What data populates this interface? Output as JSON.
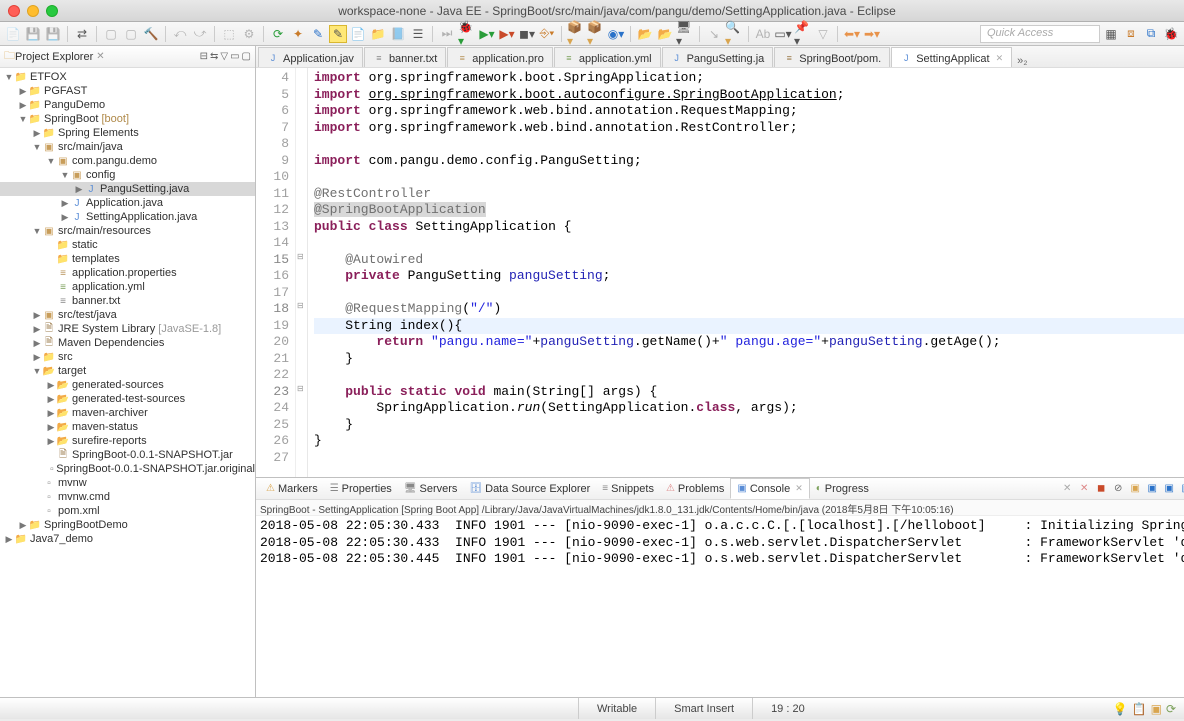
{
  "title": "workspace-none - Java EE - SpringBoot/src/main/java/com/pangu/demo/SettingApplication.java - Eclipse",
  "quick_access": "Quick Access",
  "project_explorer": {
    "title": "Project Explorer",
    "items": [
      {
        "depth": 0,
        "tw": "▼",
        "icon": "proj",
        "label": "ETFOX"
      },
      {
        "depth": 1,
        "tw": "▶",
        "icon": "proj",
        "label": "PGFAST"
      },
      {
        "depth": 1,
        "tw": "▶",
        "icon": "proj",
        "label": "PanguDemo"
      },
      {
        "depth": 1,
        "tw": "▼",
        "icon": "proj",
        "label": "SpringBoot",
        "deco": " [boot]"
      },
      {
        "depth": 2,
        "tw": "▶",
        "icon": "folder",
        "label": "Spring Elements"
      },
      {
        "depth": 2,
        "tw": "▼",
        "icon": "pkg",
        "label": "src/main/java"
      },
      {
        "depth": 3,
        "tw": "▼",
        "icon": "pkg",
        "label": "com.pangu.demo"
      },
      {
        "depth": 4,
        "tw": "▼",
        "icon": "pkg",
        "label": "config"
      },
      {
        "depth": 5,
        "tw": "▶",
        "icon": "java",
        "label": "PanguSetting.java",
        "selected": true
      },
      {
        "depth": 4,
        "tw": "▶",
        "icon": "java",
        "label": "Application.java"
      },
      {
        "depth": 4,
        "tw": "▶",
        "icon": "java",
        "label": "SettingApplication.java"
      },
      {
        "depth": 2,
        "tw": "▼",
        "icon": "pkg",
        "label": "src/main/resources"
      },
      {
        "depth": 3,
        "tw": "",
        "icon": "folder",
        "label": "static"
      },
      {
        "depth": 3,
        "tw": "",
        "icon": "folder",
        "label": "templates"
      },
      {
        "depth": 3,
        "tw": "",
        "icon": "prop",
        "label": "application.properties"
      },
      {
        "depth": 3,
        "tw": "",
        "icon": "yml",
        "label": "application.yml"
      },
      {
        "depth": 3,
        "tw": "",
        "icon": "txt",
        "label": "banner.txt"
      },
      {
        "depth": 2,
        "tw": "▶",
        "icon": "pkg",
        "label": "src/test/java"
      },
      {
        "depth": 2,
        "tw": "▶",
        "icon": "jar",
        "label": "JRE System Library",
        "ver": " [JavaSE-1.8]"
      },
      {
        "depth": 2,
        "tw": "▶",
        "icon": "jar",
        "label": "Maven Dependencies"
      },
      {
        "depth": 2,
        "tw": "▶",
        "icon": "folder",
        "label": "src"
      },
      {
        "depth": 2,
        "tw": "▼",
        "icon": "folder-orange",
        "label": "target"
      },
      {
        "depth": 3,
        "tw": "▶",
        "icon": "folder-orange",
        "label": "generated-sources"
      },
      {
        "depth": 3,
        "tw": "▶",
        "icon": "folder-orange",
        "label": "generated-test-sources"
      },
      {
        "depth": 3,
        "tw": "▶",
        "icon": "folder-orange",
        "label": "maven-archiver"
      },
      {
        "depth": 3,
        "tw": "▶",
        "icon": "folder-orange",
        "label": "maven-status"
      },
      {
        "depth": 3,
        "tw": "▶",
        "icon": "folder-orange",
        "label": "surefire-reports"
      },
      {
        "depth": 3,
        "tw": "",
        "icon": "jar",
        "label": "SpringBoot-0.0.1-SNAPSHOT.jar"
      },
      {
        "depth": 3,
        "tw": "",
        "icon": "file",
        "label": "SpringBoot-0.0.1-SNAPSHOT.jar.original"
      },
      {
        "depth": 2,
        "tw": "",
        "icon": "file",
        "label": "mvnw"
      },
      {
        "depth": 2,
        "tw": "",
        "icon": "file",
        "label": "mvnw.cmd"
      },
      {
        "depth": 2,
        "tw": "",
        "icon": "file",
        "label": "pom.xml"
      },
      {
        "depth": 1,
        "tw": "▶",
        "icon": "proj",
        "label": "SpringBootDemo"
      },
      {
        "depth": 0,
        "tw": "▶",
        "icon": "proj",
        "label": "Java7_demo"
      }
    ]
  },
  "editor_tabs": [
    {
      "icon": "J",
      "color": "#5a8dd6",
      "label": "Application.jav"
    },
    {
      "icon": "≡",
      "color": "#888",
      "label": "banner.txt"
    },
    {
      "icon": "≡",
      "color": "#b7935a",
      "label": "application.pro"
    },
    {
      "icon": "≡",
      "color": "#7ba05a",
      "label": "application.yml"
    },
    {
      "icon": "J",
      "color": "#5a8dd6",
      "label": "PanguSetting.ja"
    },
    {
      "icon": "≡",
      "color": "#9b7b4b",
      "label": "SpringBoot/pom."
    },
    {
      "icon": "J",
      "color": "#5a8dd6",
      "label": "SettingApplicat",
      "active": true,
      "close": true
    }
  ],
  "editor_extra": "»₂",
  "code_lines": [
    {
      "n": 4,
      "html": "<span class='kw'>import</span> org.springframework.boot.SpringApplication;"
    },
    {
      "n": 5,
      "html": "<span class='kw'>import</span> <span style='text-decoration:underline'>org.springframework.boot.autoconfigure.SpringBootApplication</span>;"
    },
    {
      "n": 6,
      "html": "<span class='kw'>import</span> org.springframework.web.bind.annotation.RequestMapping;"
    },
    {
      "n": 7,
      "html": "<span class='kw'>import</span> org.springframework.web.bind.annotation.RestController;"
    },
    {
      "n": 8,
      "html": ""
    },
    {
      "n": 9,
      "html": "<span class='kw'>import</span> com.pangu.demo.config.PanguSetting;"
    },
    {
      "n": 10,
      "html": ""
    },
    {
      "n": 11,
      "html": "<span class='ann'>@RestController</span>"
    },
    {
      "n": 12,
      "html": "<span class='ann-hl'>@SpringBootApplication</span>"
    },
    {
      "n": 13,
      "html": "<span class='kw'>public</span> <span class='kw'>class</span> SettingApplication {"
    },
    {
      "n": 14,
      "html": ""
    },
    {
      "n": 15,
      "fold": true,
      "html": "    <span class='ann'>@Autowired</span>"
    },
    {
      "n": 16,
      "html": "    <span class='kw'>private</span> PanguSetting <span class='mem'>panguSetting</span>;"
    },
    {
      "n": 17,
      "html": ""
    },
    {
      "n": 18,
      "fold": true,
      "html": "    <span class='ann'>@RequestMapping</span>(<span class='str'>\"/\"</span>)"
    },
    {
      "n": 19,
      "cur": true,
      "html": "    String index(){"
    },
    {
      "n": 20,
      "html": "        <span class='kw'>return</span> <span class='str'>\"pangu.name=\"</span>+<span class='mem'>panguSetting</span>.getName()+<span class='str'>\" pangu.age=\"</span>+<span class='mem'>panguSetting</span>.getAge();"
    },
    {
      "n": 21,
      "html": "    }"
    },
    {
      "n": 22,
      "html": ""
    },
    {
      "n": 23,
      "fold": true,
      "html": "    <span class='kw'>public</span> <span class='kw'>static</span> <span class='kw'>void</span> main(String[] args) {"
    },
    {
      "n": 24,
      "html": "        SpringApplication.<span class='stat'>run</span>(SettingApplication.<span class='kw'>class</span>, args);"
    },
    {
      "n": 25,
      "html": "    }"
    },
    {
      "n": 26,
      "html": "}"
    },
    {
      "n": 27,
      "html": ""
    }
  ],
  "bottom_tabs": [
    {
      "label": "Markers",
      "icon": "⚠",
      "color": "#d9a54f"
    },
    {
      "label": "Properties",
      "icon": "☰",
      "color": "#888"
    },
    {
      "label": "Servers",
      "icon": "🖥",
      "color": "#888"
    },
    {
      "label": "Data Source Explorer",
      "icon": "🗄",
      "color": "#5a8dd6"
    },
    {
      "label": "Snippets",
      "icon": "≡",
      "color": "#888"
    },
    {
      "label": "Problems",
      "icon": "⚠",
      "color": "#d88"
    },
    {
      "label": "Console",
      "icon": "▣",
      "color": "#5a8dd6",
      "active": true
    },
    {
      "label": "Progress",
      "icon": "◐",
      "color": "#7ba05a"
    }
  ],
  "console_header": "SpringBoot - SettingApplication [Spring Boot App] /Library/Java/JavaVirtualMachines/jdk1.8.0_131.jdk/Contents/Home/bin/java (2018年5月8日 下午10:05:16)",
  "console_lines": [
    "2018-05-08 22:05:30.433  INFO 1901 --- [nio-9090-exec-1] o.a.c.c.C.[.[localhost].[/helloboot]     : Initializing Spring FrameworkServle",
    "2018-05-08 22:05:30.433  INFO 1901 --- [nio-9090-exec-1] o.s.web.servlet.DispatcherServlet        : FrameworkServlet 'dispatcherServlet",
    "2018-05-08 22:05:30.445  INFO 1901 --- [nio-9090-exec-1] o.s.web.servlet.DispatcherServlet        : FrameworkServlet 'dispatcherServlet"
  ],
  "status": {
    "writable": "Writable",
    "insert": "Smart Insert",
    "pos": "19 : 20"
  }
}
